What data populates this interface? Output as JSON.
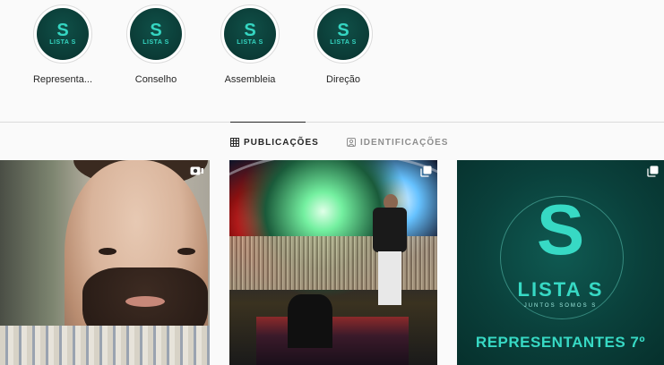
{
  "highlights": [
    {
      "label": "Representa...",
      "logo_letter": "S",
      "logo_text": "LISTA S"
    },
    {
      "label": "Conselho",
      "logo_letter": "S",
      "logo_text": "LISTA S"
    },
    {
      "label": "Assembleia",
      "logo_letter": "S",
      "logo_text": "LISTA S"
    },
    {
      "label": "Direção",
      "logo_letter": "S",
      "logo_text": "LISTA S"
    }
  ],
  "tabs": [
    {
      "label": "PUBLICAÇÕES",
      "icon": "grid-icon",
      "active": true
    },
    {
      "label": "IDENTIFICAÇÕES",
      "icon": "tag-icon",
      "active": false
    }
  ],
  "posts": [
    {
      "type": "video",
      "badge_icon": "video-icon"
    },
    {
      "type": "carousel",
      "badge_icon": "carousel-icon"
    },
    {
      "type": "carousel",
      "badge_icon": "carousel-icon",
      "logo_letter": "S",
      "logo_text": "LISTA S",
      "tagline": "JUNTOS SOMOS S",
      "caption": "REPRESENTANTES 7º"
    }
  ],
  "colors": {
    "brand_teal": "#37d9c4",
    "brand_dark": "#0a403b",
    "divider": "#dbdbdb"
  }
}
